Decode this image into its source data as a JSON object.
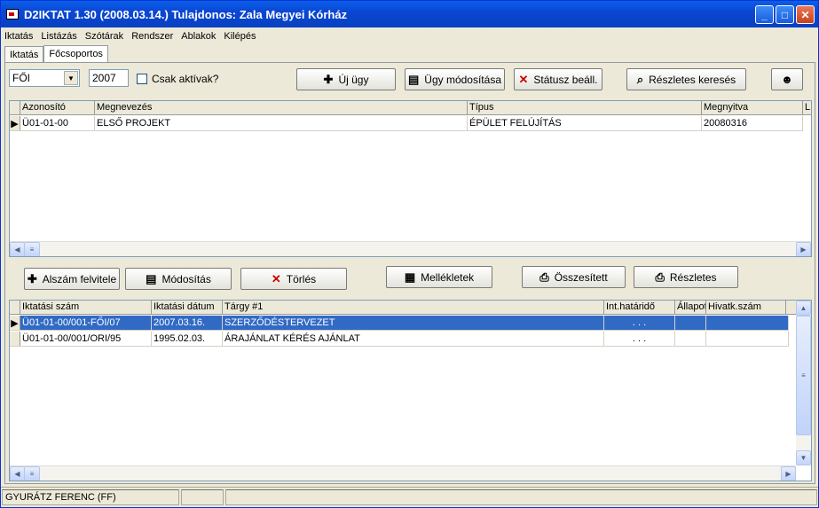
{
  "window": {
    "title": "D2IKTAT 1.30 (2008.03.14.) Tulajdonos: Zala Megyei Kórház"
  },
  "menu": [
    "Iktatás",
    "Listázás",
    "Szótárak",
    "Rendszer",
    "Ablakok",
    "Kilépés"
  ],
  "tabs": [
    "Iktatás",
    "Főcsoportos"
  ],
  "toolbar": {
    "group_value": "FŐI",
    "year_value": "2007",
    "active_only_label": "Csak aktívak?",
    "new_case": "Új ügy",
    "modify_case": "Ügy módosítása",
    "set_status": "Státusz beáll.",
    "detailed_search": "Részletes keresés"
  },
  "cases_grid": {
    "columns": [
      "Azonosító",
      "Megnevezés",
      "Típus",
      "Megnyitva",
      "L"
    ],
    "rows": [
      [
        "Ü01-01-00",
        "ELSŐ PROJEKT",
        "ÉPÜLET FELÚJÍTÁS",
        "20080316",
        ""
      ]
    ]
  },
  "mid_buttons": {
    "add_sub": "Alszám felvitele",
    "modify": "Módosítás",
    "delete": "Törlés",
    "attachments": "Mellékletek",
    "summary": "Összesített",
    "details": "Részletes"
  },
  "docs_grid": {
    "columns": [
      "Iktatási szám",
      "Iktatási dátum",
      "Tárgy #1",
      "Int.határidő",
      "Állapot",
      "Hivatk.szám"
    ],
    "rows": [
      [
        "Ü01-01-00/001-FŐI/07",
        "2007.03.16.",
        "SZERZŐDÉSTERVEZET",
        ". . .",
        "",
        ""
      ],
      [
        "Ü01-01-00/001/ORI/95",
        "1995.02.03.",
        "ÁRAJÁNLAT KÉRÉS AJÁNLAT",
        ". . .",
        "",
        ""
      ]
    ]
  },
  "status": {
    "user": "GYURÁTZ FERENC (FF)"
  }
}
